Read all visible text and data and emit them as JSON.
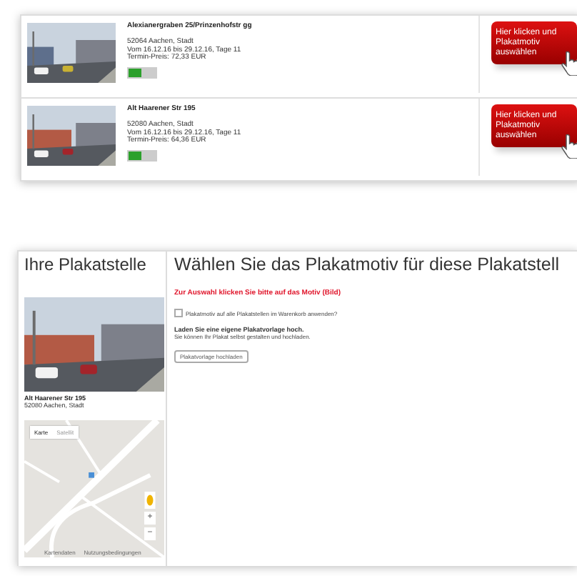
{
  "locations": [
    {
      "street": "Alexianergraben 25/Prinzenhofstr gg",
      "city": "52064 Aachen, Stadt",
      "period": "Vom 16.12.16 bis 29.12.16, Tage 11",
      "price": "Termin-Preis: 72,33 EUR",
      "on": true,
      "button": "Hier klicken und Plakatmotiv auswählen"
    },
    {
      "street": "Alt Haarener Str 195",
      "city": "52080 Aachen, Stadt",
      "period": "Vom 16.12.16 bis 29.12.16, Tage 11",
      "price": "Termin-Preis: 64,36 EUR",
      "on": true,
      "button": "Hier klicken und Plakatmotiv auswählen"
    }
  ],
  "sidebar": {
    "title": "Ihre Plakatstelle",
    "street": "Alt Haarener Str 195",
    "city": "52080 Aachen, Stadt",
    "map": {
      "tabs": [
        {
          "label": "Karte",
          "selected": true
        },
        {
          "label": "Satellit",
          "selected": false
        }
      ],
      "zoom_in": "+",
      "zoom_out": "−",
      "footer": [
        "Kartendaten",
        "Nutzungsbedingungen"
      ]
    }
  },
  "main": {
    "title": "Wählen Sie das Plakatmotiv für diese Plakatstell",
    "hint": "Zur Auswahl klicken Sie bitte auf das Motiv (Bild)",
    "apply_all": {
      "label": "Plakatmotiv auf alle Plakatstellen im Warenkorb anwenden?",
      "checked": false
    },
    "upload_title": "Laden Sie eine eigene Plakatvorlage hoch.",
    "upload_text": "Sie können Ihr Plakat selbst gestalten und hochladen.",
    "upload_button": "Plakatvorlage hochladen"
  }
}
